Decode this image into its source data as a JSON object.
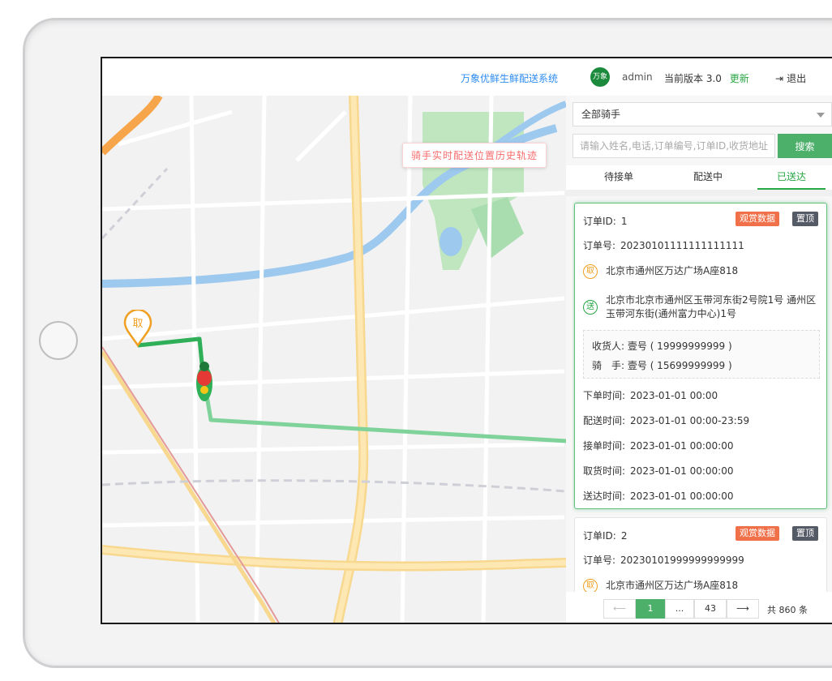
{
  "header": {
    "system_title": "万象优鲜生鲜配送系统",
    "logo_text": "万象",
    "user": "admin",
    "version_label": "当前版本",
    "version": "3.0",
    "update_label": "更新",
    "logout_label": "退出"
  },
  "map": {
    "overlay_title": "骑手实时配送位置历史轨迹",
    "pickup_marker": "取"
  },
  "filters": {
    "rider_select": "全部骑手",
    "search_placeholder": "请输入姓名,电话,订单编号,订单ID,收货地址",
    "search_button": "搜索"
  },
  "tabs": [
    {
      "label": "待接单"
    },
    {
      "label": "配送中"
    },
    {
      "label": "已送达"
    }
  ],
  "orders": [
    {
      "order_id_label": "订单ID:",
      "order_id": "1",
      "badge_observe": "观赏数据",
      "badge_pin": "置顶",
      "order_no_label": "订单号:",
      "order_no": "20230101111111111111",
      "pickup_icon": "取",
      "pickup_address": "北京市通州区万达广场A座818",
      "send_icon": "送",
      "send_address": "北京市北京市通州区玉带河东街2号院1号 通州区玉带河东街(通州富力中心)1号",
      "receiver_label": "收货人:",
      "receiver": "壹号 ( 19999999999 )",
      "rider_label": "骑　手:",
      "rider": "壹号 ( 15699999999 )",
      "times": [
        {
          "label": "下单时间:",
          "value": "2023-01-01 00:00"
        },
        {
          "label": "配送时间:",
          "value": "2023-01-01 00:00-23:59"
        },
        {
          "label": "接单时间:",
          "value": "2023-01-01 00:00:00"
        },
        {
          "label": "取货时间:",
          "value": "2023-01-01 00:00:00"
        },
        {
          "label": "送达时间:",
          "value": "2023-01-01 00:00:00"
        }
      ]
    },
    {
      "order_id_label": "订单ID:",
      "order_id": "2",
      "badge_observe": "观赏数据",
      "badge_pin": "置顶",
      "order_no_label": "订单号:",
      "order_no": "20230101999999999999",
      "pickup_icon": "取",
      "pickup_address": "北京市通州区万达广场A座818"
    }
  ],
  "pagination": {
    "prev": "⟵",
    "current": "1",
    "dots": "...",
    "last": "43",
    "next": "⟶",
    "total": "共 860 条"
  },
  "colors": {
    "accent_green": "#4caf6a",
    "link_blue": "#2d8cf0",
    "badge_orange": "#f0704a",
    "badge_dark": "#555a67"
  }
}
